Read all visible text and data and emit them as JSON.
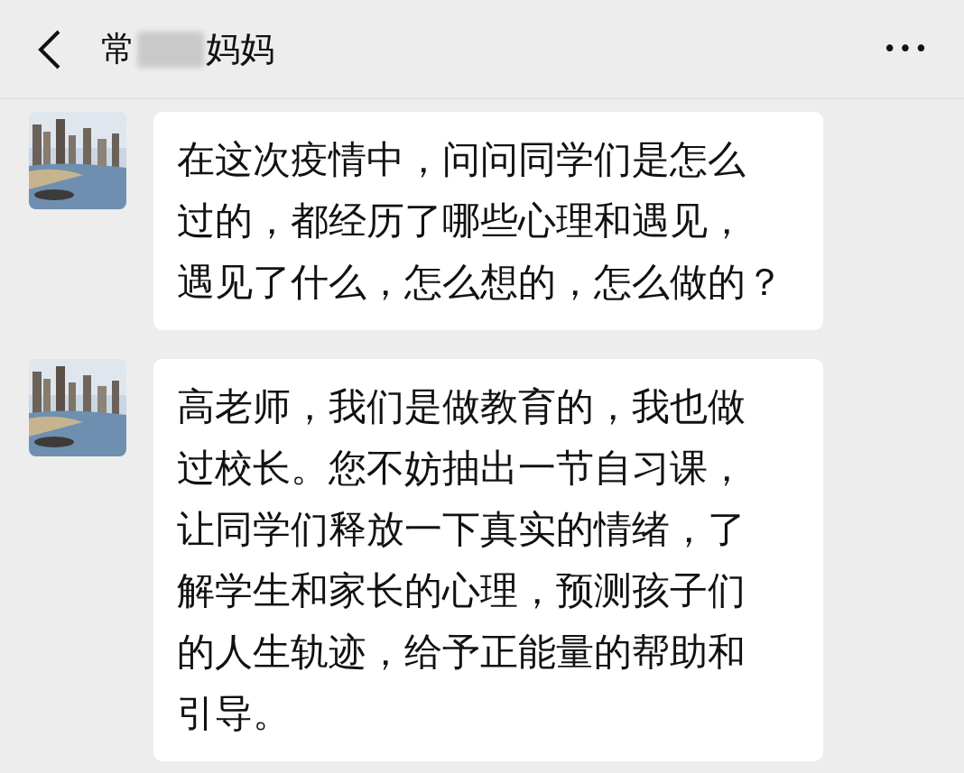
{
  "header": {
    "title_parts": [
      "常",
      "妈妈"
    ],
    "more": "•••"
  },
  "messages": [
    {
      "lines": [
        "在这次疫情中，问问同学们是怎么",
        "过的，都经历了哪些心理和遇见，",
        "遇见了什么，怎么想的，怎么做的？"
      ]
    },
    {
      "lines": [
        "高老师，我们是做教育的，我也做",
        "过校长。您不妨抽出一节自习课，",
        "让同学们释放一下真实的情绪，了",
        "解学生和家长的心理，预测孩子们",
        "的人生轨迹，给予正能量的帮助和",
        "引导。"
      ]
    }
  ]
}
